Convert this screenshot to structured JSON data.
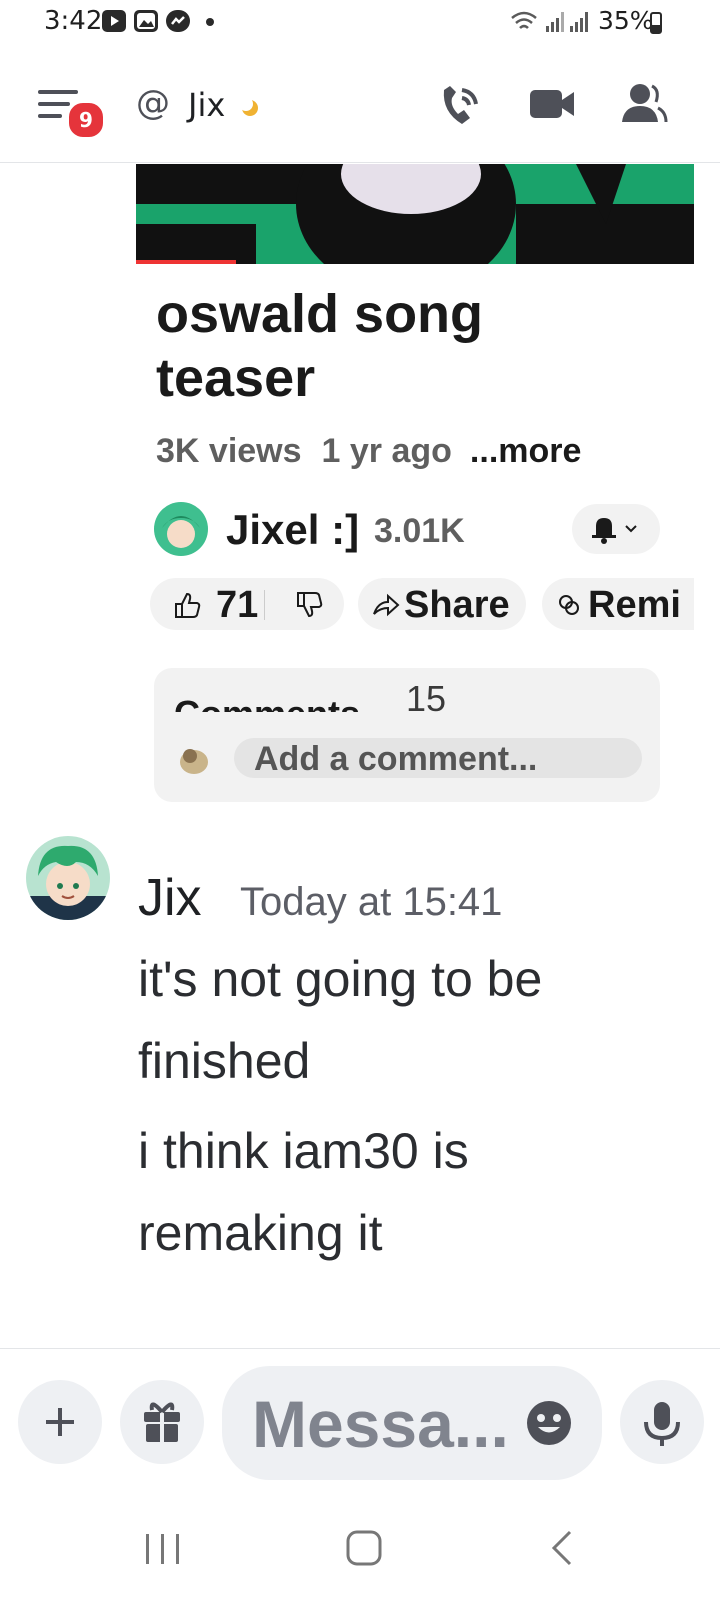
{
  "status_bar": {
    "time": "3:42",
    "battery": "35%",
    "notification_icons": [
      "youtube-icon",
      "gallery-icon",
      "messenger-icon",
      "dot-icon"
    ],
    "system_icons": [
      "wifi-icon",
      "signal-icon",
      "signal-icon",
      "battery-icon"
    ]
  },
  "header": {
    "badge_count": "9",
    "channel_name": "Jix",
    "icons": [
      "menu-icon",
      "at-icon",
      "moon-status-icon",
      "phone-call-icon",
      "video-call-icon",
      "members-icon"
    ]
  },
  "embed": {
    "title_line1": "oswald song",
    "title_line2": "teaser",
    "views": "3K views",
    "age": "1 yr ago",
    "more": "...more",
    "channel_name": "Jixel :]",
    "subscribers": "3.01K",
    "likes": "71",
    "share_label": "Share",
    "remix_label": "Remi",
    "comments_label": "Comments",
    "comments_count": "15",
    "comment_placeholder": "Add a comment..."
  },
  "message": {
    "author": "Jix",
    "timestamp": "Today at 15:41",
    "lines": [
      "it's not going to be",
      "finished",
      "i think iam30 is",
      "remaking it"
    ]
  },
  "composer": {
    "placeholder": "Messa...",
    "buttons": [
      "plus-icon",
      "gift-icon",
      "emoji-icon",
      "mic-icon"
    ]
  },
  "colors": {
    "badge": "#e5343b",
    "moon": "#f0b232",
    "thumbnail_green": "#1aa36b",
    "input_bg": "#eef0f3"
  }
}
